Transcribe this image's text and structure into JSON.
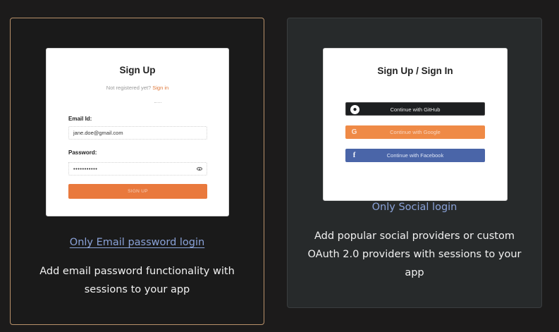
{
  "email_card": {
    "preview": {
      "title": "Sign Up",
      "subtitle_prefix": "Not registered yet?",
      "subtitle_link": "Sign in",
      "email_label": "Email Id:",
      "email_value": "jane.doe@gmail.com",
      "password_label": "Password:",
      "password_value": "•••••••••••",
      "button_label": "SIGN UP"
    },
    "link": "Only Email password login",
    "description": "Add email password functionality with sessions to your app"
  },
  "social_card": {
    "preview": {
      "title": "Sign Up / Sign In",
      "buttons": [
        {
          "label": "Continue with GitHub",
          "icon": "github-icon"
        },
        {
          "label": "Continue with Google",
          "icon": "google-icon"
        },
        {
          "label": "Continue with Facebook",
          "icon": "facebook-icon"
        }
      ]
    },
    "link": "Only Social login",
    "description": "Add popular social providers or custom OAuth 2.0 providers with sessions to your app"
  },
  "colors": {
    "accent_orange": "#e9793d",
    "link_blue": "#8aa2d8",
    "github_dark": "#1d1f21",
    "facebook_blue": "#4a65a8",
    "email_card_border": "#b8916a"
  }
}
